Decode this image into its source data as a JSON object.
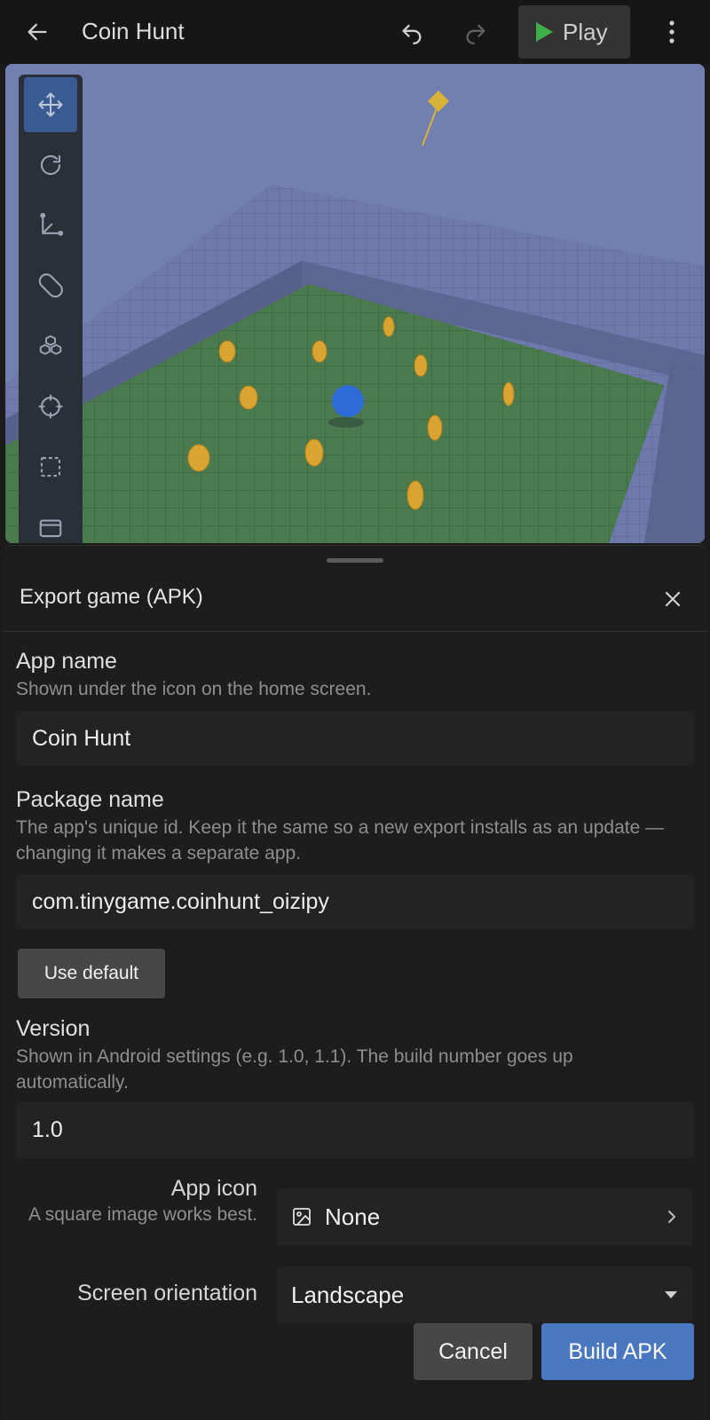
{
  "topbar": {
    "title": "Coin Hunt",
    "play_label": "Play",
    "icons": {
      "back": "arrow-left-icon",
      "undo": "undo-icon",
      "redo": "redo-icon",
      "play": "play-icon",
      "more": "more-vertical-icon"
    }
  },
  "viewport": {
    "tools": [
      "move-icon",
      "rotate-icon",
      "scale-icon",
      "magnet-icon",
      "cubes-icon",
      "crosshair-icon",
      "select-box-icon",
      "window-icon"
    ],
    "active_tool": "move-icon"
  },
  "sheet": {
    "title": "Export game (APK)",
    "app_name": {
      "label": "App name",
      "help": "Shown under the icon on the home screen.",
      "value": "Coin Hunt"
    },
    "package_name": {
      "label": "Package name",
      "help": "The app's unique id. Keep it the same so a new export installs as an update — changing it makes a separate app.",
      "value": "com.tinygame.coinhunt_oizipy",
      "use_default_label": "Use default"
    },
    "version": {
      "label": "Version",
      "help": "Shown in Android settings (e.g. 1.0, 1.1). The build number goes up automatically.",
      "value": "1.0"
    },
    "app_icon": {
      "label": "App icon",
      "help": "A square image works best.",
      "value": "None"
    },
    "orientation": {
      "label": "Screen orientation",
      "value": "Landscape"
    },
    "cancel_label": "Cancel",
    "build_label": "Build APK"
  },
  "colors": {
    "accent": "#4a78c0",
    "background": "#1d1d1d",
    "play": "#3fae49"
  }
}
